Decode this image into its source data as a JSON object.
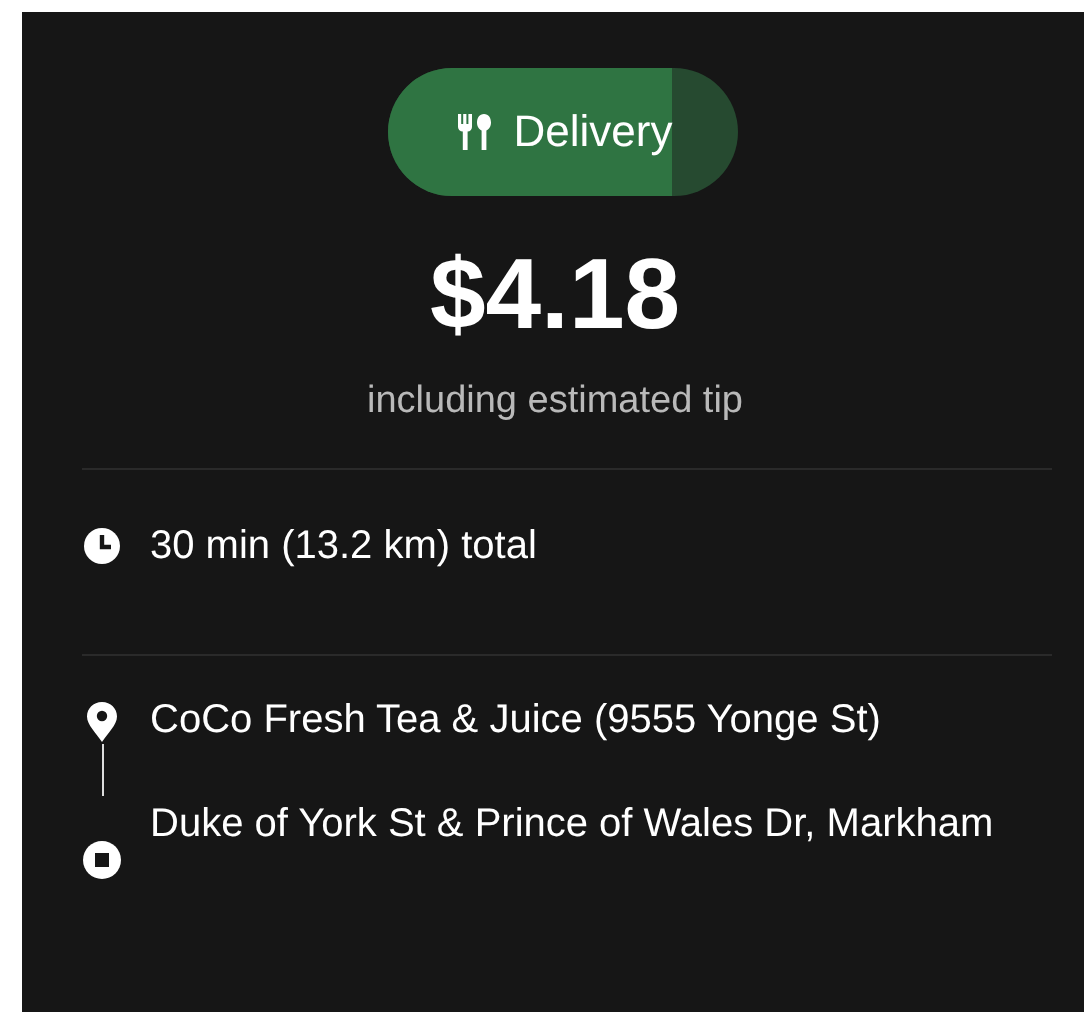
{
  "mode_pill": {
    "label": "Delivery",
    "level": 0.81
  },
  "price": "$4.18",
  "price_note": "including estimated tip",
  "trip": {
    "summary": "30 min (13.2 km) total"
  },
  "stops": [
    {
      "kind": "pickup",
      "address": "CoCo Fresh Tea & Juice (9555 Yonge St)"
    },
    {
      "kind": "dropoff",
      "address": "Duke of York St & Prince of Wales Dr, Markham"
    }
  ]
}
